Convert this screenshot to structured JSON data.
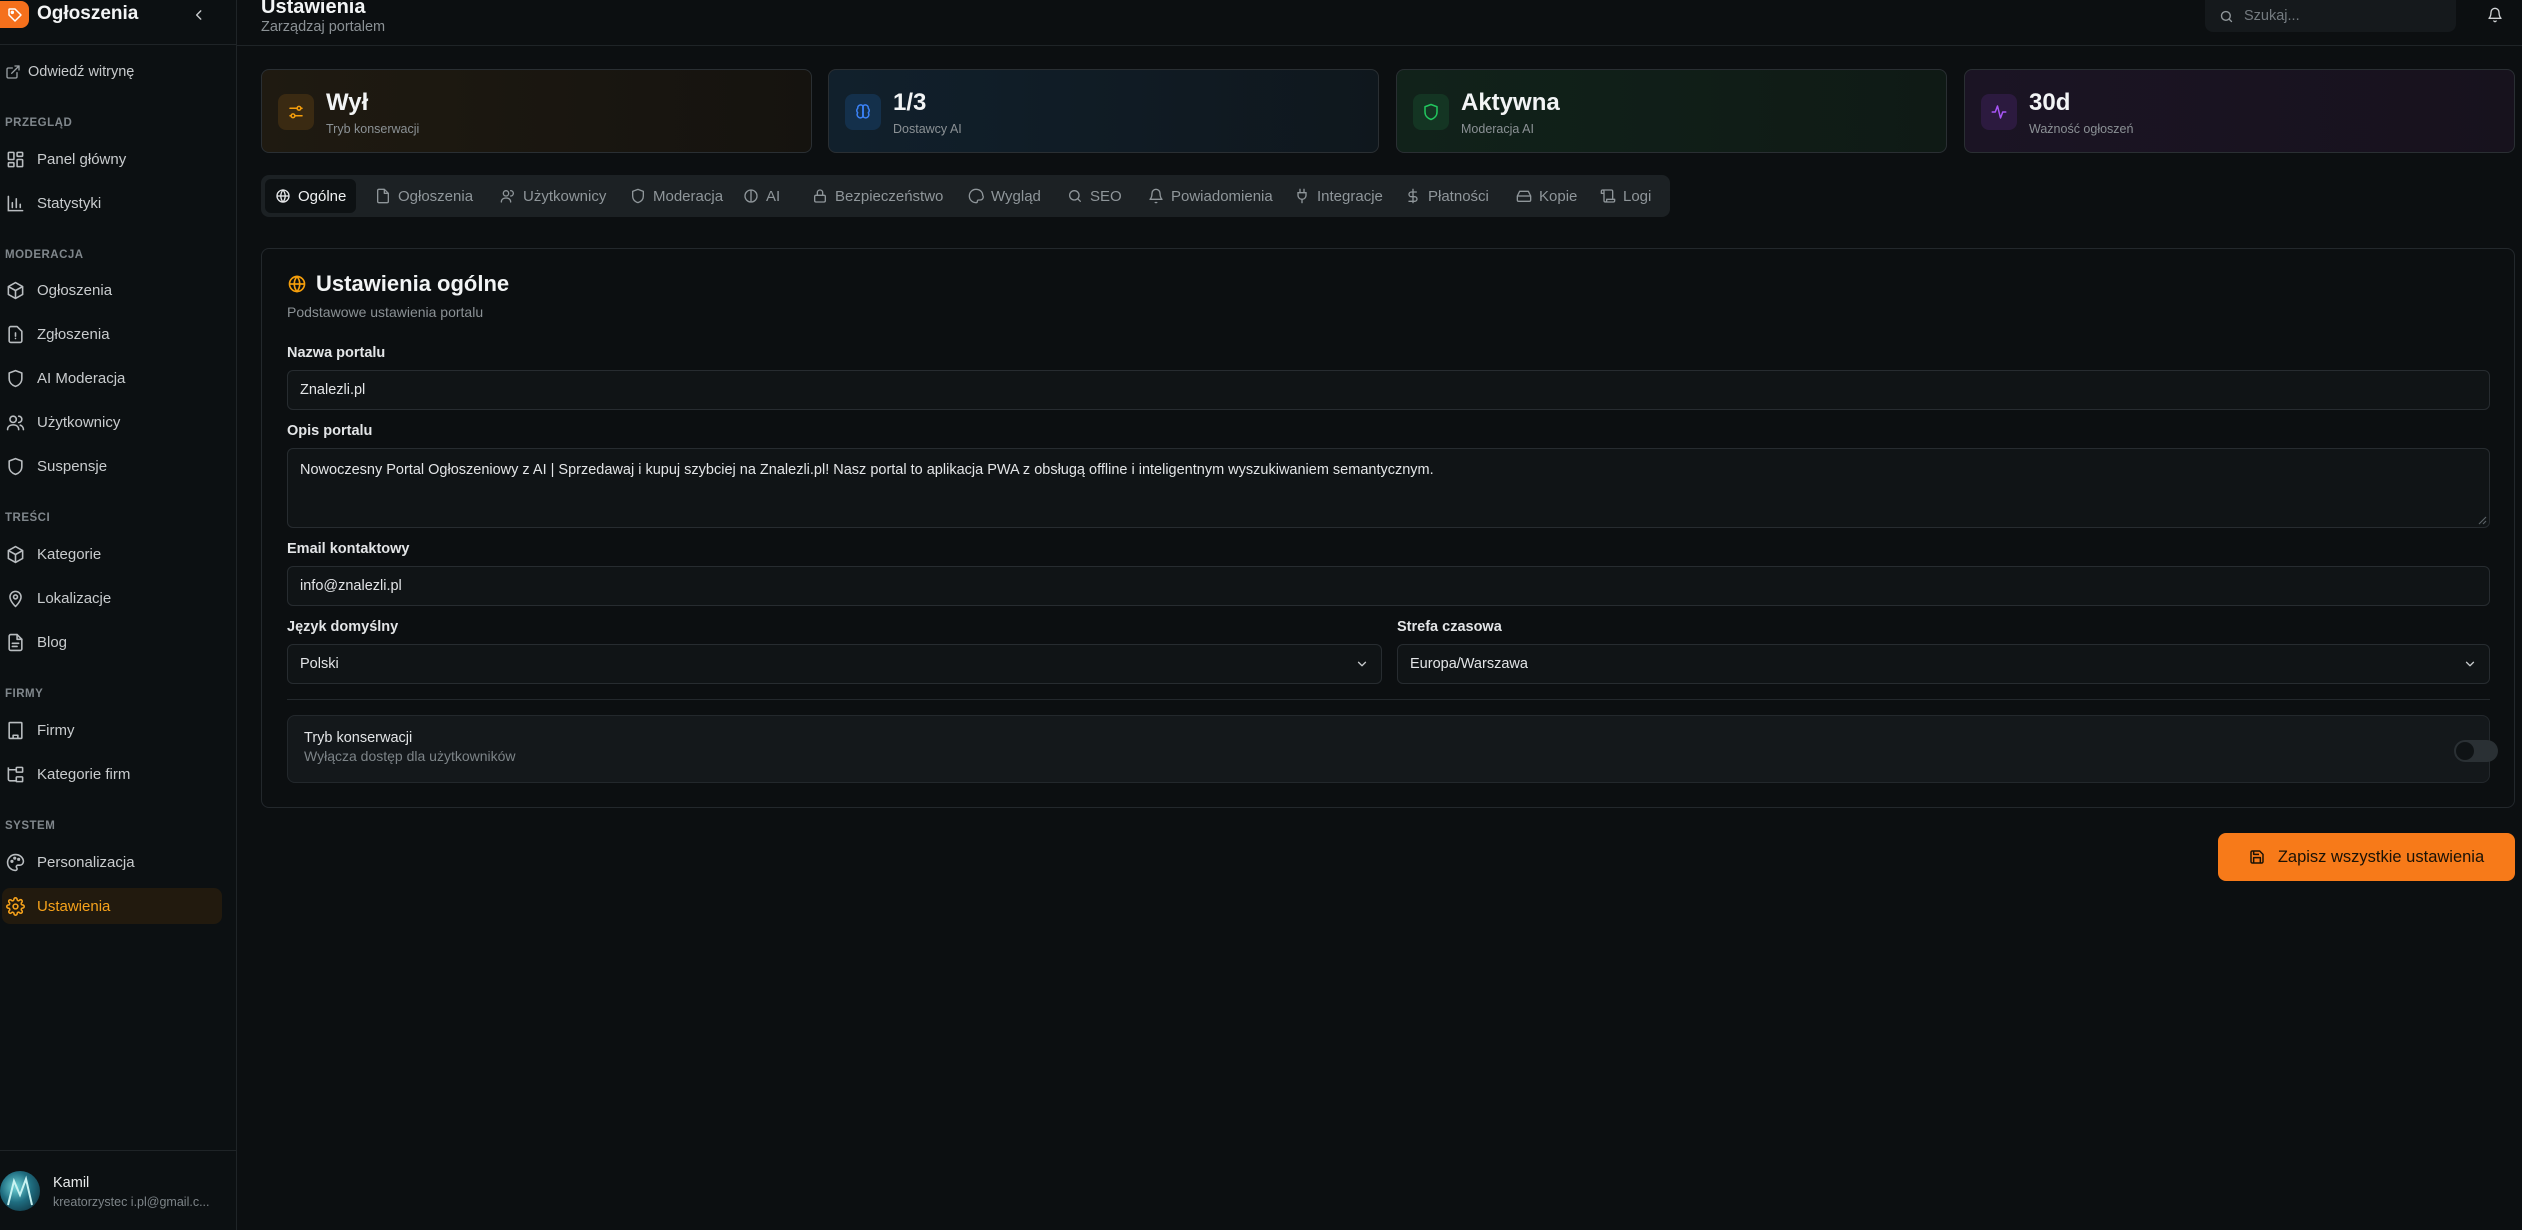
{
  "sidebar": {
    "brand_title": "Ogłoszenia",
    "visit_site": "Odwiedź witrynę",
    "sections": {
      "przeglad": "PRZEGLĄD",
      "moderacja": "MODERACJA",
      "tresci": "TREŚCI",
      "firmy": "FIRMY",
      "system": "SYSTEM"
    },
    "items": {
      "panel_glowny": "Panel główny",
      "statystyki": "Statystyki",
      "ogloszenia": "Ogłoszenia",
      "zgloszenia": "Zgłoszenia",
      "ai_moderacja": "AI Moderacja",
      "uzytkownicy": "Użytkownicy",
      "suspensje": "Suspensje",
      "kategorie": "Kategorie",
      "lokalizacje": "Lokalizacje",
      "blog": "Blog",
      "firmy": "Firmy",
      "kategorie_firm": "Kategorie firm",
      "personalizacja": "Personalizacja",
      "ustawienia": "Ustawienia"
    },
    "user": {
      "name": "Kamil",
      "email": "kreatorzystec i.pl@gmail.c..."
    }
  },
  "header": {
    "title": "Ustawienia",
    "subtitle": "Zarządzaj portalem",
    "search_placeholder": "Szukaj..."
  },
  "stats": [
    {
      "value": "Wył",
      "label": "Tryb konserwacji"
    },
    {
      "value": "1/3",
      "label": "Dostawcy AI"
    },
    {
      "value": "Aktywna",
      "label": "Moderacja AI"
    },
    {
      "value": "30d",
      "label": "Ważność ogłoszeń"
    }
  ],
  "tabs": {
    "ogolne": "Ogólne",
    "ogloszenia": "Ogłoszenia",
    "uzytkownicy": "Użytkownicy",
    "moderacja": "Moderacja",
    "ai": "AI",
    "bezpieczenstwo": "Bezpieczeństwo",
    "wyglad": "Wygląd",
    "seo": "SEO",
    "powiadomienia": "Powiadomienia",
    "integracje": "Integracje",
    "platnosci": "Płatności",
    "kopie": "Kopie",
    "logi": "Logi"
  },
  "general": {
    "title": "Ustawienia ogólne",
    "subtitle": "Podstawowe ustawienia portalu",
    "portal_name_label": "Nazwa portalu",
    "portal_name_value": "Znalezli.pl",
    "description_label": "Opis portalu",
    "description_value": "Nowoczesny Portal Ogłoszeniowy z AI | Sprzedawaj i kupuj szybciej na Znalezli.pl! Nasz portal to aplikacja PWA z obsługą offline i inteligentnym wyszukiwaniem semantycznym.",
    "email_label": "Email kontaktowy",
    "email_value": "info@znalezli.pl",
    "language_label": "Język domyślny",
    "language_value": "Polski",
    "timezone_label": "Strefa czasowa",
    "timezone_value": "Europa/Warszawa",
    "maintenance_title": "Tryb konserwacji",
    "maintenance_desc": "Wyłącza dostęp dla użytkowników",
    "maintenance_enabled": false
  },
  "save_button": "Zapisz wszystkie ustawienia",
  "colors": {
    "accent": "#f77a19",
    "active_nav": "#f6a21b",
    "stat_orange": "#f59e0b",
    "stat_blue": "#3b82f6",
    "stat_green": "#22c55e",
    "stat_purple": "#a855f7"
  }
}
